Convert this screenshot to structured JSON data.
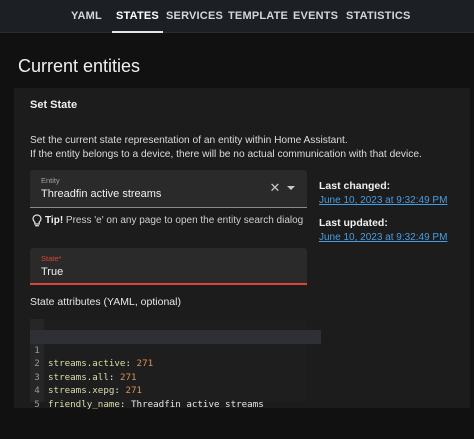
{
  "tabs": [
    {
      "label": "YAML",
      "active": false
    },
    {
      "label": "STATES",
      "active": true
    },
    {
      "label": "SERVICES",
      "active": false
    },
    {
      "label": "TEMPLATE",
      "active": false
    },
    {
      "label": "EVENTS",
      "active": false
    },
    {
      "label": "STATISTICS",
      "active": false
    }
  ],
  "page_title": "Current entities",
  "set_state": {
    "title": "Set State",
    "description_line1": "Set the current state representation of an entity within Home Assistant.",
    "description_line2": "If the entity belongs to a device, there will be no actual communication with that device."
  },
  "entity_field": {
    "label": "Entity",
    "value": "Threadfin active streams"
  },
  "tip": {
    "strong": "Tip!",
    "text": " Press 'e' on any page to open the entity search dialog"
  },
  "state_field": {
    "label": "State*",
    "value": "True"
  },
  "last_changed": {
    "label": "Last changed:",
    "value": "June 10, 2023 at 9:32:49 PM"
  },
  "last_updated": {
    "label": "Last updated:",
    "value": "June 10, 2023 at 9:32:49 PM"
  },
  "attributes": {
    "title": "State attributes (YAML, optional)",
    "lines": [
      {
        "num": "1",
        "key": "streams.active",
        "value": "271"
      },
      {
        "num": "2",
        "key": "streams.all",
        "value": "271"
      },
      {
        "num": "3",
        "key": "streams.xepg",
        "value": "271"
      },
      {
        "num": "4",
        "key": "friendly_name",
        "value": "Threadfin active streams"
      },
      {
        "num": "5",
        "key": "",
        "value": ""
      }
    ]
  },
  "colors": {
    "accent_link": "#4a9ce0",
    "error": "#db4437",
    "background": "#111111"
  }
}
